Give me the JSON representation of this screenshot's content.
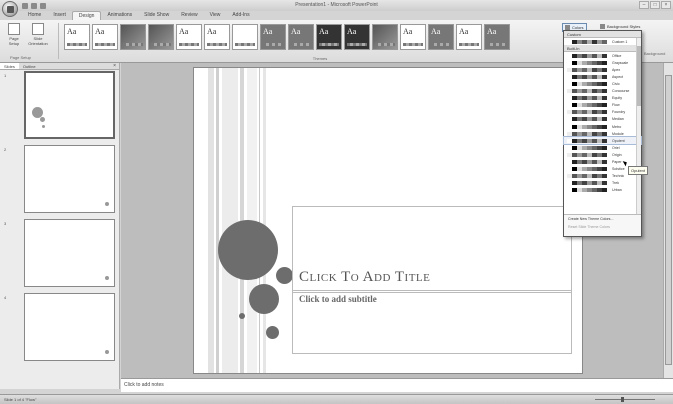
{
  "app": {
    "title": "Presentation1 - Microsoft PowerPoint"
  },
  "tabs": [
    {
      "label": "Home"
    },
    {
      "label": "Insert"
    },
    {
      "label": "Design"
    },
    {
      "label": "Animations"
    },
    {
      "label": "Slide Show"
    },
    {
      "label": "Review"
    },
    {
      "label": "View"
    },
    {
      "label": "Add-Ins"
    }
  ],
  "ribbon": {
    "page_setup": {
      "label": "Page Setup",
      "orientation": "Slide Orientation",
      "group": "Page Setup"
    },
    "themes_group": "Themes",
    "colors_button": "Colors",
    "background_styles": "Background Styles",
    "background_group": "Background"
  },
  "left_pane": {
    "tab_slides": "Slides",
    "tab_outline": "Outline",
    "slide_numbers": [
      "1",
      "2",
      "3",
      "4"
    ]
  },
  "slide": {
    "title_placeholder": "Click to add title",
    "subtitle_placeholder": "Click to add subtitle"
  },
  "notes": {
    "placeholder": "Click to add notes"
  },
  "status": {
    "text": "Slide 1 of 4   \"Flow\""
  },
  "colors_dropdown": {
    "custom_header": "Custom",
    "builtin_header": "Built-In",
    "custom_item": "Custom 1",
    "items": [
      "Office",
      "Grayscale",
      "Apex",
      "Aspect",
      "Civic",
      "Concourse",
      "Equity",
      "Flow",
      "Foundry",
      "Median",
      "Metro",
      "Module",
      "Opulent",
      "Oriel",
      "Origin",
      "Paper",
      "Solstice",
      "Technic",
      "Trek",
      "Urban"
    ],
    "create_new": "Create New Theme Colors...",
    "reset": "Reset Slide Theme Colors",
    "hover_item": "Opulent",
    "tooltip": "Opulent"
  }
}
